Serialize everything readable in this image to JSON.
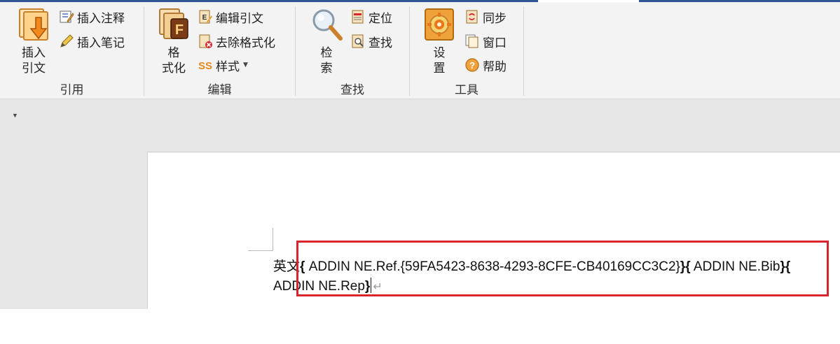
{
  "ribbon": {
    "groups": [
      {
        "label": "引用",
        "big_button": {
          "label": "插入\n引文",
          "icon": "insert-citation-icon"
        },
        "small_buttons": [
          {
            "label": "插入注释",
            "icon": "insert-note-icon"
          },
          {
            "label": "插入笔记",
            "icon": "insert-memo-icon"
          }
        ]
      },
      {
        "label": "编辑",
        "big_button": {
          "label": "格\n式化",
          "icon": "format-icon"
        },
        "small_buttons": [
          {
            "label": "编辑引文",
            "icon": "edit-citation-icon"
          },
          {
            "label": "去除格式化",
            "icon": "remove-format-icon"
          },
          {
            "label": "样式",
            "icon": "style-icon",
            "has_dropdown": true
          }
        ]
      },
      {
        "label": "查找",
        "big_button": {
          "label": "检\n索",
          "icon": "magnifier-icon"
        },
        "small_buttons": [
          {
            "label": "定位",
            "icon": "locate-icon"
          },
          {
            "label": "查找",
            "icon": "find-icon"
          }
        ]
      },
      {
        "label": "工具",
        "big_button": {
          "label": "设\n置",
          "icon": "settings-gear-icon"
        },
        "small_buttons": [
          {
            "label": "同步",
            "icon": "sync-icon"
          },
          {
            "label": "窗口",
            "icon": "window-icon"
          },
          {
            "label": "帮助",
            "icon": "help-icon"
          }
        ]
      }
    ]
  },
  "document": {
    "line1": {
      "cn_prefix": "英文",
      "brace_open_1": "{",
      "field_code_1": " ADDIN NE.Ref.{59FA5423-8638-4293-8CFE-CB40169CC3C2}",
      "brace_close_1": "}",
      "brace_open_2": "{",
      "field_code_2": " ADDIN NE.Bib",
      "brace_close_2": "}",
      "brace_open_3": "{"
    },
    "line2": {
      "field_code_3": "ADDIN NE.Rep",
      "brace_close_3": "}",
      "paragraph_mark": "↵"
    }
  },
  "colors": {
    "accent": "#2f5597",
    "highlight_border": "#d9262e",
    "ribbon_bg": "#f3f3f3",
    "doc_bg": "#e6e6e6"
  }
}
